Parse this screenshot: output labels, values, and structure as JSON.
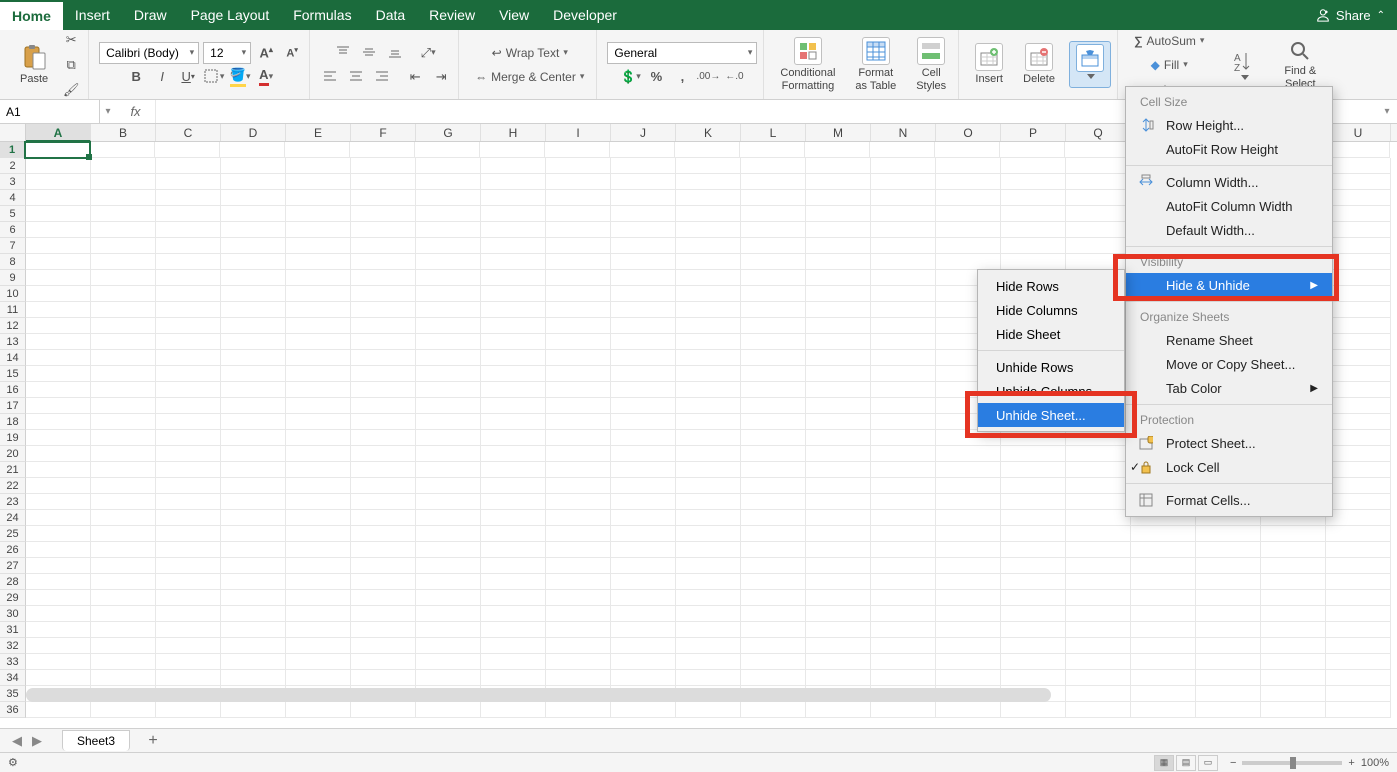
{
  "tabs": [
    "Home",
    "Insert",
    "Draw",
    "Page Layout",
    "Formulas",
    "Data",
    "Review",
    "View",
    "Developer"
  ],
  "active_tab": "Home",
  "share_label": "Share",
  "ribbon": {
    "paste": "Paste",
    "font_name": "Calibri (Body)",
    "font_size": "12",
    "wrap_text": "Wrap Text",
    "merge_center": "Merge & Center",
    "number_format": "General",
    "cond_fmt": "Conditional\nFormatting",
    "fmt_table": "Format\nas Table",
    "cell_styles": "Cell\nStyles",
    "insert": "Insert",
    "delete": "Delete",
    "autosum": "AutoSum",
    "fill": "Fill",
    "find_select": "Find &\nSelect"
  },
  "cell_ref": "A1",
  "columns": [
    "A",
    "B",
    "C",
    "D",
    "E",
    "F",
    "G",
    "H",
    "I",
    "J",
    "K",
    "L",
    "M",
    "N",
    "O",
    "P",
    "Q",
    "R",
    "S",
    "T",
    "U"
  ],
  "row_count": 36,
  "sheet_name": "Sheet3",
  "zoom": "100%",
  "format_menu": {
    "section_cell_size": "Cell Size",
    "row_height": "Row Height...",
    "autofit_row": "AutoFit Row Height",
    "col_width": "Column Width...",
    "autofit_col": "AutoFit Column Width",
    "default_width": "Default Width...",
    "section_visibility": "Visibility",
    "hide_unhide": "Hide & Unhide",
    "section_organize": "Organize Sheets",
    "rename": "Rename Sheet",
    "move_copy": "Move or Copy Sheet...",
    "tab_color": "Tab Color",
    "section_protection": "Protection",
    "protect": "Protect Sheet...",
    "lock_cell": "Lock Cell",
    "format_cells": "Format Cells..."
  },
  "sub_menu": {
    "hide_rows": "Hide Rows",
    "hide_cols": "Hide Columns",
    "hide_sheet": "Hide Sheet",
    "unhide_rows": "Unhide Rows",
    "unhide_cols": "Unhide Columns",
    "unhide_sheet": "Unhide Sheet..."
  }
}
